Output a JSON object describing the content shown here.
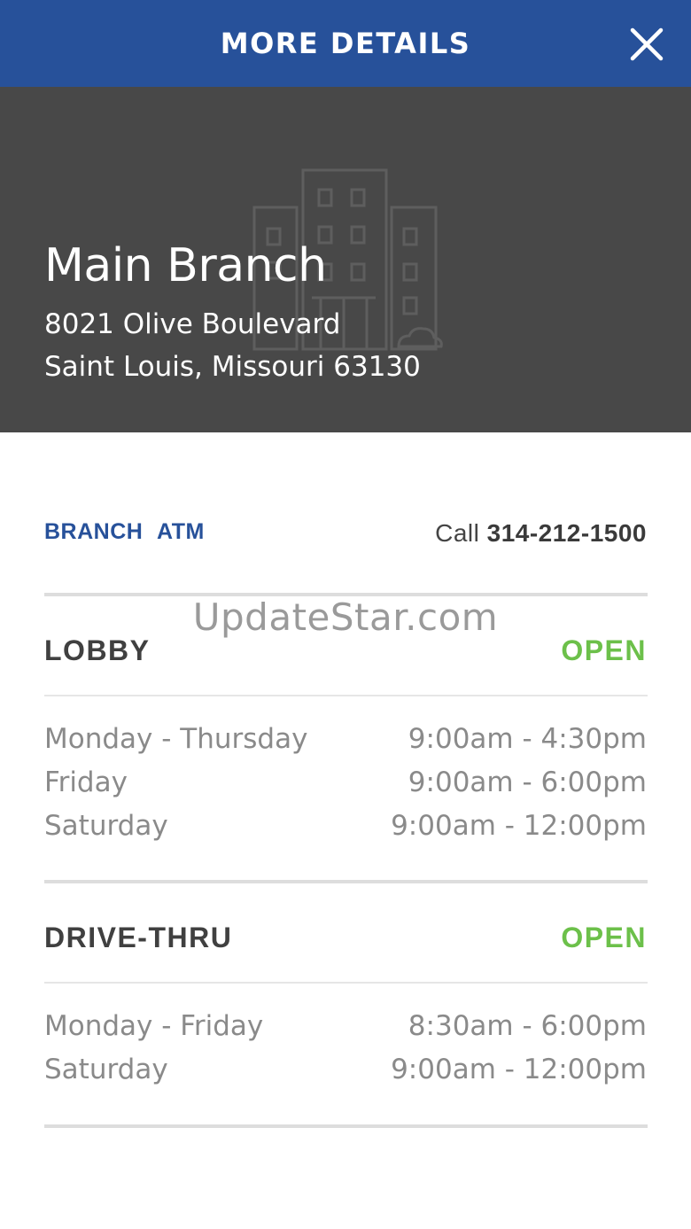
{
  "header": {
    "title": "MORE DETAILS",
    "close_icon": "close-icon",
    "bg_color": "#27519a"
  },
  "hero": {
    "icon": "building-icon",
    "name": "Main Branch",
    "address_line1": "8021 Olive Boulevard",
    "address_line2": "Saint Louis, Missouri 63130",
    "bg_color": "#484848"
  },
  "tabs": {
    "branch": "BRANCH",
    "atm": "ATM"
  },
  "contact": {
    "call_label": "Call",
    "phone": "314-212-1500"
  },
  "lobby": {
    "title": "LOBBY",
    "status": "OPEN",
    "hours": [
      {
        "day": "Monday - Thursday",
        "time": "9:00am - 4:30pm"
      },
      {
        "day": "Friday",
        "time": "9:00am - 6:00pm"
      },
      {
        "day": "Saturday",
        "time": "9:00am - 12:00pm"
      }
    ]
  },
  "drive_thru": {
    "title": "DRIVE-THRU",
    "status": "OPEN",
    "hours": [
      {
        "day": "Monday - Friday",
        "time": "8:30am - 6:00pm"
      },
      {
        "day": "Saturday",
        "time": "9:00am - 12:00pm"
      }
    ]
  },
  "watermark": "UpdateStar.com",
  "colors": {
    "accent": "#27519a",
    "open": "#6cc04a"
  }
}
